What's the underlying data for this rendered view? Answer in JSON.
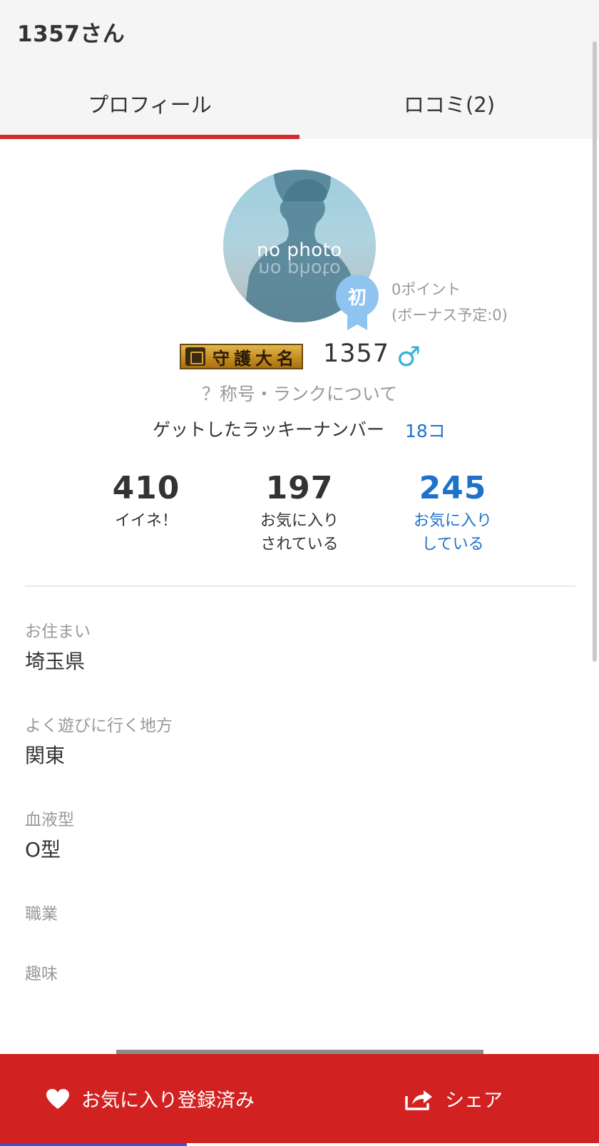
{
  "header": {
    "title": "1357さん"
  },
  "tabs": [
    {
      "label": "プロフィール",
      "active": true
    },
    {
      "label": "ロコミ(2)",
      "active": false
    }
  ],
  "profile": {
    "no_photo": "no photo",
    "badge": "初",
    "points": "0ポイント",
    "bonus": "(ボーナス予定:0)",
    "rank_title": "守護大名",
    "username": "1357",
    "gender_symbol": "♂",
    "rank_about": "？称号・ランクについて",
    "lucky_label": "ゲットしたラッキーナンバー",
    "lucky_count": "18コ"
  },
  "stats": [
    {
      "value": "410",
      "label_line1": "イイネ！",
      "label_line2": ""
    },
    {
      "value": "197",
      "label_line1": "お気に入り",
      "label_line2": "されている"
    },
    {
      "value": "245",
      "label_line1": "お気に入り",
      "label_line2": "している"
    }
  ],
  "details": [
    {
      "label": "お住まい",
      "value": "埼玉県"
    },
    {
      "label": "よく遊びに行く地方",
      "value": "関東"
    },
    {
      "label": "血液型",
      "value": "O型"
    },
    {
      "label": "職業",
      "value": ""
    },
    {
      "label": "趣味",
      "value": ""
    }
  ],
  "actions": {
    "favorite": "お気に入り登録済み",
    "share": "シェア"
  },
  "colors": {
    "accent_red": "#d12120",
    "link_blue": "#1e73c9",
    "gender_blue": "#3ab0e0",
    "badge_blue": "#8fc3f0"
  },
  "icons": {
    "favorite": "heart-icon",
    "share": "share-icon",
    "gender": "male-icon",
    "badge": "ribbon-badge-icon"
  }
}
